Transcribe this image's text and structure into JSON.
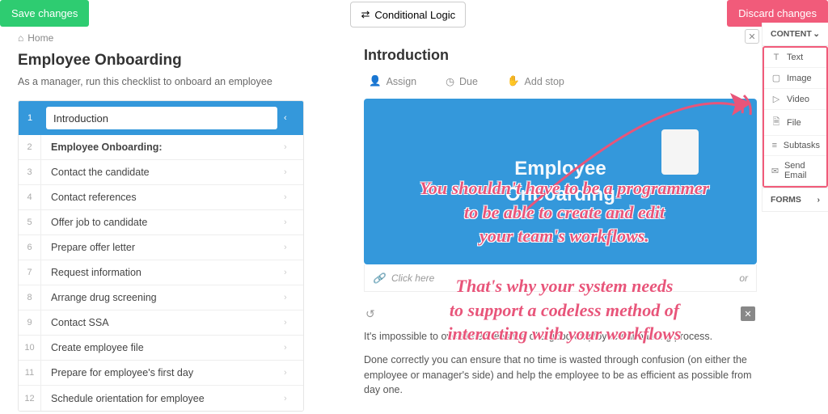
{
  "topbar": {
    "save_label": "Save changes",
    "conditional_label": "Conditional Logic",
    "discard_label": "Discard changes"
  },
  "breadcrumb": {
    "home": "Home"
  },
  "template": {
    "title": "Employee Onboarding",
    "subtitle": "As a manager, run this checklist to onboard an employee"
  },
  "tasks": [
    {
      "n": "1",
      "label": "Introduction",
      "active": true
    },
    {
      "n": "2",
      "label": "Employee Onboarding:",
      "heading": true
    },
    {
      "n": "3",
      "label": "Contact the candidate"
    },
    {
      "n": "4",
      "label": "Contact references"
    },
    {
      "n": "5",
      "label": "Offer job to candidate"
    },
    {
      "n": "6",
      "label": "Prepare offer letter"
    },
    {
      "n": "7",
      "label": "Request information"
    },
    {
      "n": "8",
      "label": "Arrange drug screening"
    },
    {
      "n": "9",
      "label": "Contact SSA"
    },
    {
      "n": "10",
      "label": "Create employee file"
    },
    {
      "n": "11",
      "label": "Prepare for employee's first day"
    },
    {
      "n": "12",
      "label": "Schedule orientation for employee"
    }
  ],
  "content": {
    "title": "Introduction",
    "assign": "Assign",
    "due": "Due",
    "add_stop": "Add stop",
    "image_title": "Employee\nOnboarding",
    "caption_placeholder": "Click here",
    "paragraphs": [
      "It's impossible to overstate the value of a good employee onboarding process.",
      "Done correctly you can ensure that no time is wasted through confusion (on either the employee or manager's side) and help the employee to be as efficient as possible from day one."
    ]
  },
  "right_panel": {
    "content_label": "CONTENT",
    "forms_label": "FORMS",
    "items": [
      {
        "icon": "T",
        "label": "Text"
      },
      {
        "icon": "▢",
        "label": "Image"
      },
      {
        "icon": "▷",
        "label": "Video"
      },
      {
        "icon": "🗎",
        "label": "File"
      },
      {
        "icon": "≡",
        "label": "Subtasks"
      },
      {
        "icon": "✉",
        "label": "Send Email"
      }
    ]
  },
  "annotation": {
    "line1": "You shouldn't have to be a programmer",
    "line2": "to be able to create and edit",
    "line3": "your team's workflows.",
    "line4": "That's why your system needs",
    "line5": "to support a codeless method of",
    "line6": "interacting with your workflows"
  }
}
